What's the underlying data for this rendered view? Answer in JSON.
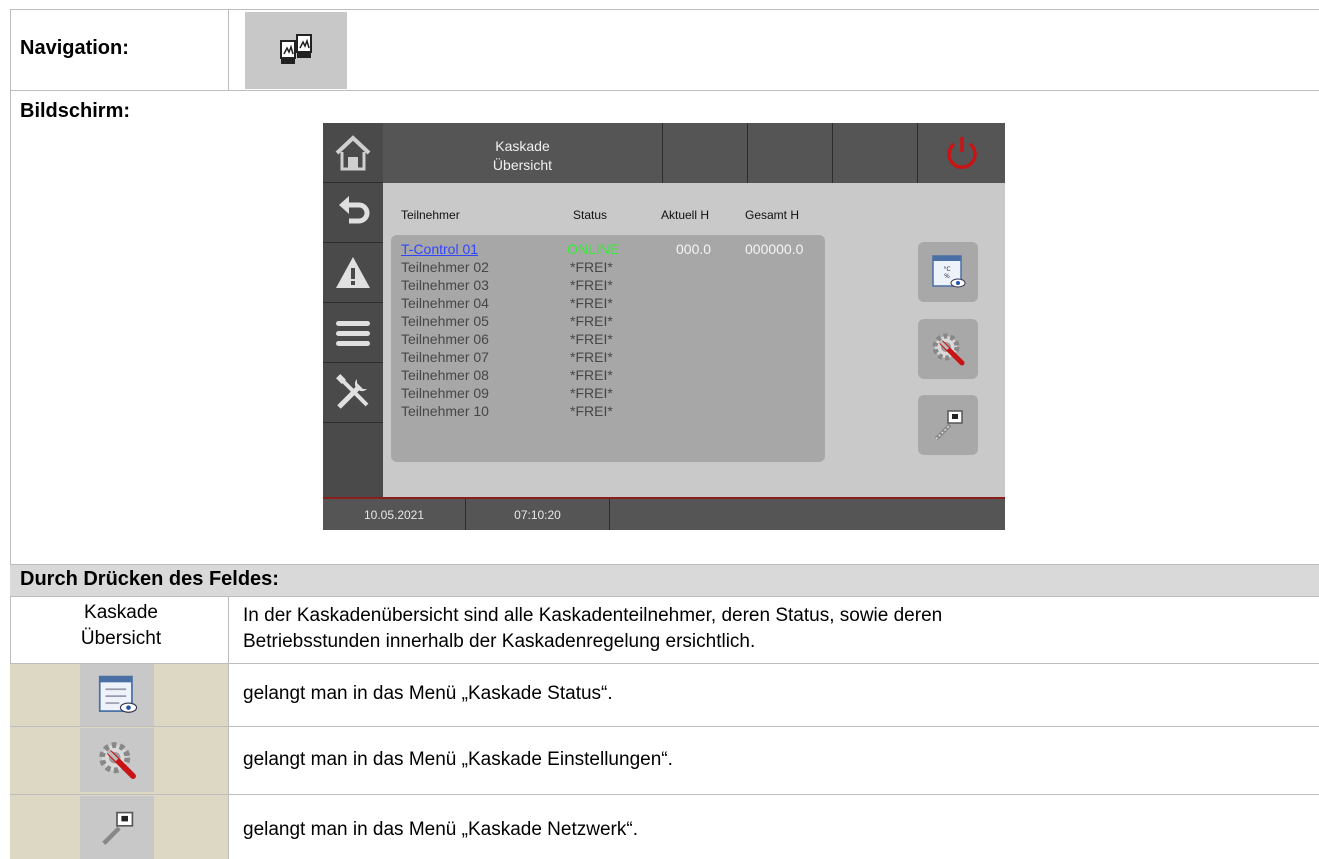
{
  "navigation": {
    "label": "Navigation:",
    "icon": "cascade-boilers-icon"
  },
  "screen_section": {
    "label": "Bildschirm:"
  },
  "device": {
    "title_line1": "Kaskade",
    "title_line2": "Übersicht",
    "sidebar": [
      "home-icon",
      "back-icon",
      "warning-icon",
      "menu-icon",
      "tools-icon"
    ],
    "power_icon": "power-icon",
    "columns": {
      "participant": "Teilnehmer",
      "status": "Status",
      "current": "Aktuell H",
      "total": "Gesamt H"
    },
    "rows": [
      {
        "name": "T-Control 01",
        "status": "ONLINE",
        "current": "000.0",
        "total": "000000.0"
      },
      {
        "name": "Teilnehmer 02",
        "status": "*FREI*"
      },
      {
        "name": "Teilnehmer 03",
        "status": "*FREI*"
      },
      {
        "name": "Teilnehmer 04",
        "status": "*FREI*"
      },
      {
        "name": "Teilnehmer 05",
        "status": "*FREI*"
      },
      {
        "name": "Teilnehmer 06",
        "status": "*FREI*"
      },
      {
        "name": "Teilnehmer 07",
        "status": "*FREI*"
      },
      {
        "name": "Teilnehmer 08",
        "status": "*FREI*"
      },
      {
        "name": "Teilnehmer 09",
        "status": "*FREI*"
      },
      {
        "name": "Teilnehmer 10",
        "status": "*FREI*"
      }
    ],
    "side_buttons": [
      "status-view-icon",
      "settings-tools-icon",
      "network-icon"
    ],
    "date": "10.05.2021",
    "time": "07:10:20",
    "colors": {
      "online": "#33ee33",
      "link": "#3344ff",
      "power": "#c81414"
    }
  },
  "press_section": {
    "label": "Durch Drücken des Feldes:",
    "rows": [
      {
        "field_line1": "Kaskade",
        "field_line2": "Übersicht",
        "line1": "In der Kaskadenübersicht sind alle Kaskadenteilnehmer, deren Status, sowie deren",
        "line2": "Betriebsstunden innerhalb der Kaskadenregelung ersichtlich."
      },
      {
        "icon": "status-view-icon",
        "text": "gelangt man in das Menü „Kaskade Status“."
      },
      {
        "icon": "settings-tools-icon",
        "text": "gelangt man in das Menü „Kaskade Einstellungen“."
      },
      {
        "icon": "network-icon",
        "text": "gelangt man in das Menü „Kaskade Netzwerk“."
      }
    ]
  }
}
